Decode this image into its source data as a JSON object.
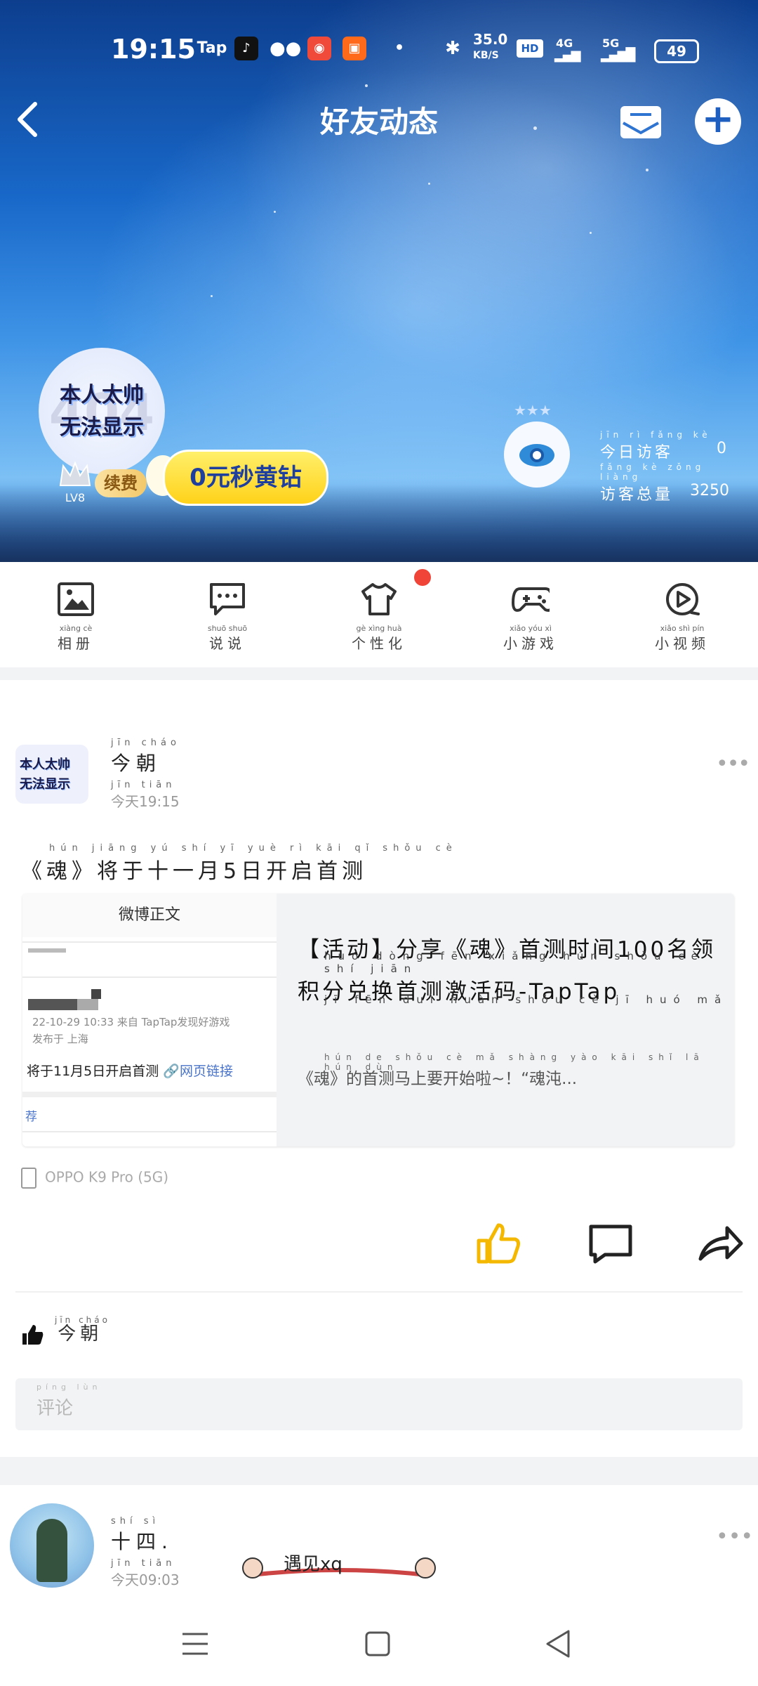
{
  "status_bar": {
    "time": "19:15",
    "tap_label": "Tap",
    "net_speed_value": "35.0",
    "net_speed_unit": "KB/S",
    "hd_label": "HD",
    "sim1": "4G",
    "sim2": "5G",
    "battery": "49",
    "colors": {
      "tiktok": "#111111",
      "wechat": "#ffffff",
      "weibo_app": "#f04a3b",
      "kuaishou": "#ff6a1a"
    }
  },
  "header": {
    "title": "好友动态",
    "back_icon": "chevron-left-icon",
    "mail_icon": "mail-icon",
    "add_icon": "plus-circle-icon"
  },
  "profile": {
    "avatar_line1": "本人太帅",
    "avatar_line2": "无法显示",
    "avatar_ghost": "404",
    "level": "LV8",
    "renew_label": "续费",
    "vip_button": "0元秒黄钻",
    "visitors_today_label": "今日访客",
    "visitors_today_pinyin": "jīn rì fǎng kè",
    "visitors_today_value": "0",
    "visitors_total_label": "访客总量",
    "visitors_total_pinyin": "fǎng kè zǒng liàng",
    "visitors_total_value": "3250"
  },
  "quick_menu": [
    {
      "pinyin": "xiàng cè",
      "label": "相册",
      "icon": "photo-album-icon"
    },
    {
      "pinyin": "shuō shuō",
      "label": "说说",
      "icon": "chat-bubble-icon"
    },
    {
      "pinyin": "gè xìng huà",
      "label": "个性化",
      "icon": "tshirt-icon"
    },
    {
      "pinyin": "xiǎo yóu xì",
      "label": "小游戏",
      "icon": "gamepad-icon"
    },
    {
      "pinyin": "xiǎo shì pín",
      "label": "小视频",
      "icon": "video-play-icon"
    }
  ],
  "post1": {
    "author_pinyin": "jīn cháo",
    "author": "今朝",
    "time_pinyin": "jīn tiān",
    "time": "今天19:15",
    "text_pinyin": "hún jiāng yú shí yī yuè rì kāi qǐ shǒu cè",
    "text": "《魂》将于十一月5日开启首测",
    "link_card": {
      "thumb_header": "微博正文",
      "thumb_meta_1": "22-10-29 10:33  来自 TapTap发现好游戏",
      "thumb_meta_2": "发布于 上海",
      "thumb_main": "将于11月5日开启首测",
      "thumb_link": "🔗网页链接",
      "thumb_rec": "荐",
      "title_pinyin_1": "huó dòng fēn xiǎng hún shǒu cè shí jiān",
      "title_pinyin_2": "jī fēn duì huàn shǒu cè jī huó mǎ",
      "title": "【活动】分享《魂》首测时间100名领积分兑换首测激活码-TapTap",
      "desc_pinyin": "hún de shǒu cè mǎ shàng yào kāi shǐ lā hún dùn",
      "desc": "《魂》的首测马上要开始啦~！“魂沌..."
    },
    "device": "OPPO K9 Pro (5G)",
    "actions": {
      "like_icon": "thumbs-up-icon",
      "comment_icon": "comment-icon",
      "share_icon": "share-arrow-icon"
    },
    "likes_pinyin": "jīn cháo",
    "likes": "今朝",
    "comment_pinyin": "píng lùn",
    "comment_placeholder": "评论",
    "accent": "#f5b800"
  },
  "post2": {
    "author_pinyin": "shí sì",
    "author": "十四.",
    "time_pinyin": "jīn tiān",
    "time": "今天09:03",
    "deco_text": "遇见xq"
  },
  "nav_bar": {
    "menu_icon": "menu-lines-icon",
    "home_icon": "square-home-icon",
    "back_icon": "triangle-back-icon"
  }
}
